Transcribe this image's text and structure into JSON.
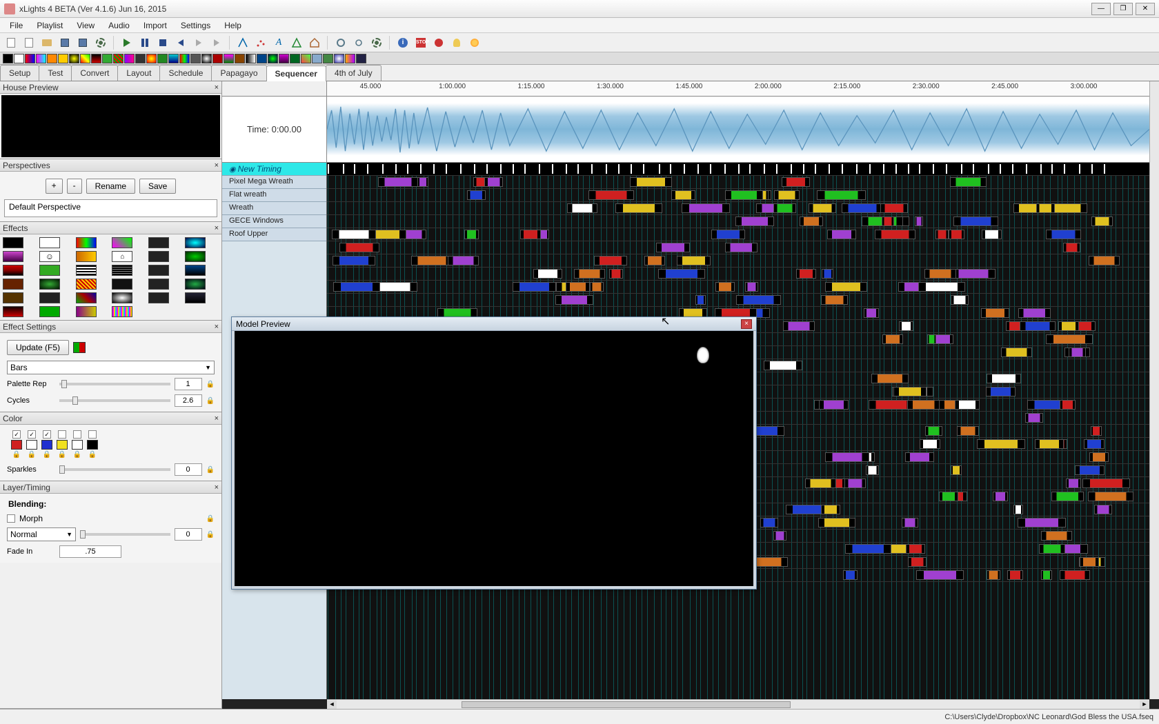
{
  "window": {
    "title": "xLights 4 BETA (Ver 4.1.6) Jun 16, 2015"
  },
  "menus": [
    "File",
    "Playlist",
    "View",
    "Audio",
    "Import",
    "Settings",
    "Help"
  ],
  "tabs": [
    "Setup",
    "Test",
    "Convert",
    "Layout",
    "Schedule",
    "Papagayo",
    "Sequencer",
    "4th of July"
  ],
  "active_tab": "Sequencer",
  "panels": {
    "house_preview": "House Preview",
    "perspectives": "Perspectives",
    "effects": "Effects",
    "effect_settings": "Effect Settings",
    "color": "Color",
    "layer_timing": "Layer/Timing",
    "model_preview": "Model Preview"
  },
  "perspectives": {
    "add": "+",
    "remove": "-",
    "rename": "Rename",
    "save": "Save",
    "current": "Default Perspective"
  },
  "effect_settings": {
    "update": "Update (F5)",
    "dropdown": "Bars",
    "palette_rep_label": "Palette Rep",
    "palette_rep_val": "1",
    "cycles_label": "Cycles",
    "cycles_val": "2.6"
  },
  "color": {
    "sparkles_label": "Sparkles",
    "sparkles_val": "0",
    "colors": [
      "#d02020",
      "#ffffff",
      "#2030d0",
      "#f0e020",
      "#ffffff",
      "#000000"
    ],
    "checked": [
      true,
      true,
      true,
      false,
      false,
      false
    ]
  },
  "layer_timing": {
    "blending_label": "Blending:",
    "morph_label": "Morph",
    "mode": "Normal",
    "mode_val": "0",
    "fadein_label": "Fade In",
    "fadein_val": ".75"
  },
  "timeline": {
    "time_label": "Time: 0:00.00",
    "ticks": [
      "45.000",
      "1:00.000",
      "1:15.000",
      "1:30.000",
      "1:45.000",
      "2:00.000",
      "2:15.000",
      "2:30.000",
      "2:45.000",
      "3:00.000"
    ]
  },
  "tracks": [
    "New Timing",
    "Pixel Mega Wreath",
    "Flat wreath",
    "Wreath",
    "GECE Windows",
    "Roof Upper"
  ],
  "status": {
    "path": "C:\\Users\\Clyde\\Dropbox\\NC Leonard\\God Bless the USA.fseq"
  }
}
